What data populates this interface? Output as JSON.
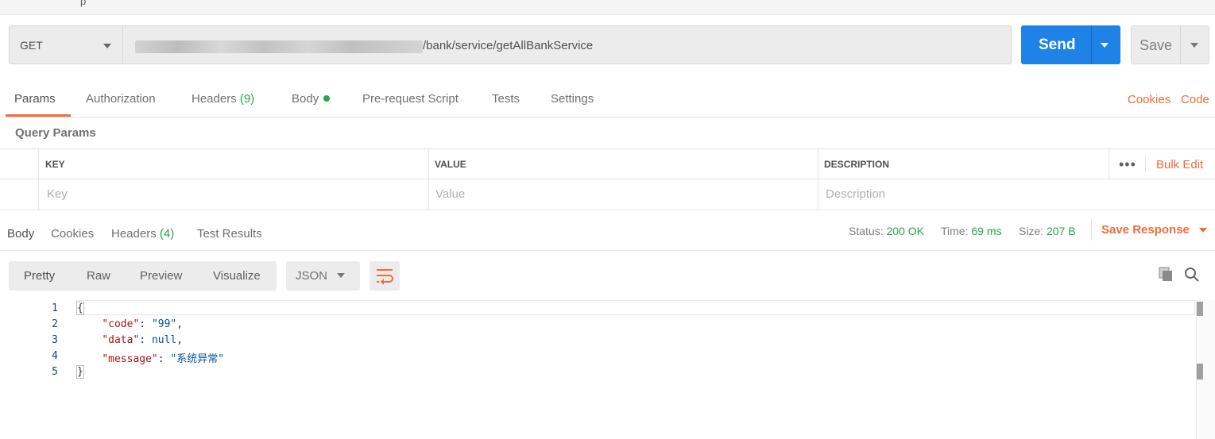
{
  "top_fragment": "p",
  "request": {
    "method": "GET",
    "url_path": "/bank/service/getAllBankService",
    "send_label": "Send",
    "save_label": "Save"
  },
  "request_tabs": {
    "params": "Params",
    "authorization": "Authorization",
    "headers": "Headers",
    "headers_count": "(9)",
    "body": "Body",
    "prerequest": "Pre-request Script",
    "tests": "Tests",
    "settings": "Settings",
    "cookies": "Cookies",
    "code": "Code"
  },
  "query_params": {
    "title": "Query Params",
    "columns": {
      "key": "KEY",
      "value": "VALUE",
      "description": "DESCRIPTION"
    },
    "placeholders": {
      "key": "Key",
      "value": "Value",
      "description": "Description"
    },
    "more": "•••",
    "bulk_edit": "Bulk Edit"
  },
  "response_tabs": {
    "body": "Body",
    "cookies": "Cookies",
    "headers": "Headers",
    "headers_count": "(4)",
    "test_results": "Test Results"
  },
  "status": {
    "status_label": "Status:",
    "status_value": "200 OK",
    "time_label": "Time:",
    "time_value": "69 ms",
    "size_label": "Size:",
    "size_value": "207 B",
    "save_response": "Save Response"
  },
  "view": {
    "pretty": "Pretty",
    "raw": "Raw",
    "preview": "Preview",
    "visualize": "Visualize",
    "format": "JSON"
  },
  "code": {
    "line_numbers": [
      "1",
      "2",
      "3",
      "4",
      "5"
    ],
    "open_brace": "{",
    "close_brace": "}",
    "code_key": "\"code\"",
    "code_value": "\"99\"",
    "data_key": "\"data\"",
    "data_value": "null",
    "message_key": "\"message\"",
    "message_value": "\"系统异常\""
  },
  "colors": {
    "accent": "#f26b3a",
    "send": "#1e82e6",
    "success": "#26a54a"
  }
}
